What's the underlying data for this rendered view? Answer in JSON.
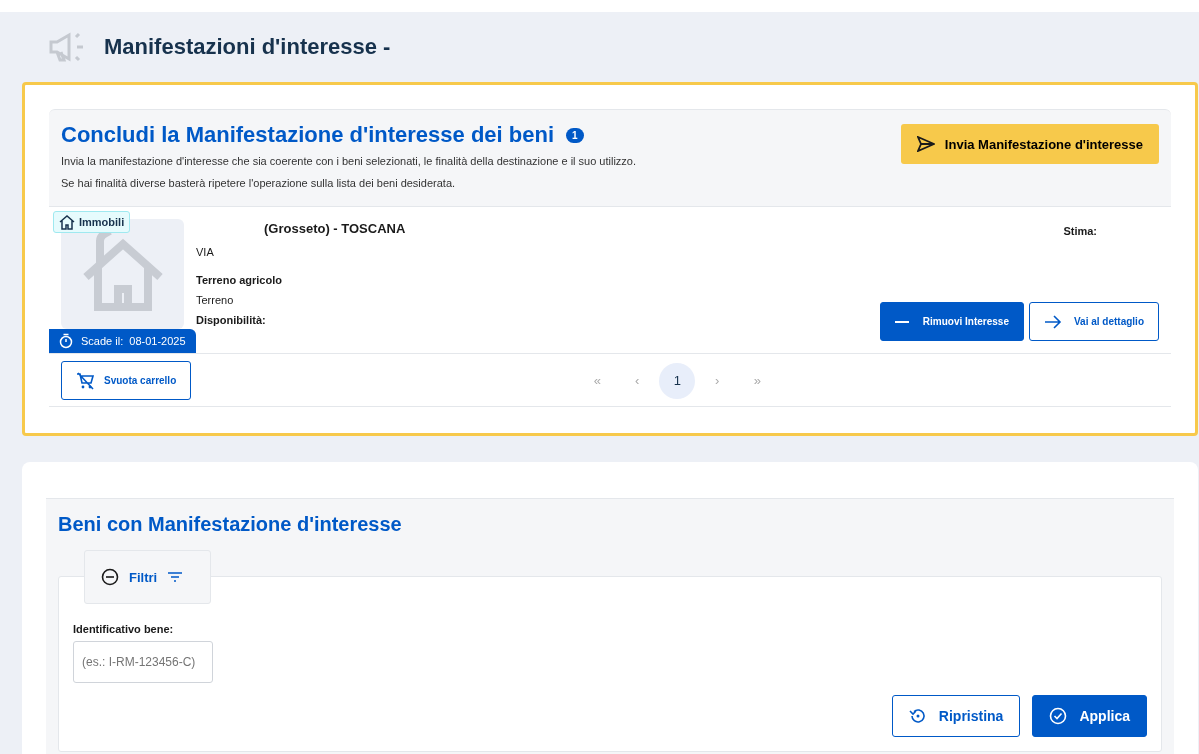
{
  "page_title": "Manifestazioni d'interesse - ",
  "cart": {
    "title": "Concludi la Manifestazione d'interesse dei beni",
    "count": "1",
    "description": [
      "Invia la manifestazione d'interesse che sia coerente con i beni selezionati, le finalità della destinazione e il suo utilizzo.",
      "Se hai finalità diverse basterà ripetere l'operazione sulla lista dei beni desiderata."
    ],
    "send_button": "Invia Manifestazione d'interesse",
    "item": {
      "category": "Immobili",
      "location": "(Grosseto) - TOSCANA",
      "address": "VIA",
      "type": "Terreno agricolo",
      "subtype": "Terreno",
      "availability_label": "Disponibilità:",
      "estimate_label": "Stima:",
      "expiry_label": "Scade il:",
      "expiry_date": "08-01-2025",
      "remove_button": "Rimuovi Interesse",
      "detail_button": "Vai al dettaglio"
    },
    "empty_button": "Svuota carrello",
    "pagination": [
      {
        "label": "«",
        "selected": false
      },
      {
        "label": "‹",
        "selected": false
      },
      {
        "label": "1",
        "selected": true
      },
      {
        "label": "›",
        "selected": false
      },
      {
        "label": "»",
        "selected": false
      }
    ]
  },
  "assets": {
    "title": "Beni con Manifestazione d'interesse",
    "filters": {
      "label": "Filtri",
      "expanded": true,
      "field_label": "Identificativo bene:",
      "placeholder": "(es.: I-RM-123456-C)",
      "reset_button": "Ripristina",
      "apply_button": "Applica"
    }
  }
}
